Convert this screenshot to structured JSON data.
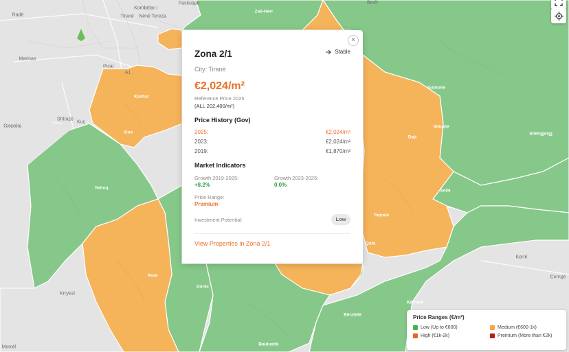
{
  "map": {
    "places": [
      {
        "name": "Radë",
        "tone": "dark"
      },
      {
        "name": "Tiranë",
        "tone": "dark"
      },
      {
        "name": "Nënë Tereza",
        "tone": "dark"
      },
      {
        "name": "Kombëtar i",
        "tone": "dark"
      },
      {
        "name": "Zall-Herr",
        "tone": "light"
      },
      {
        "name": "Besh",
        "tone": "dark"
      },
      {
        "name": "Paskuqan",
        "tone": "dark"
      },
      {
        "name": "Marinas",
        "tone": "dark"
      },
      {
        "name": "Picar",
        "tone": "dark"
      },
      {
        "name": "A1",
        "tone": "dark"
      },
      {
        "name": "Kashar",
        "tone": "light"
      },
      {
        "name": "Shtrazë",
        "tone": "dark"
      },
      {
        "name": "Kuç",
        "tone": "dark"
      },
      {
        "name": "Gjepalaj",
        "tone": "dark"
      },
      {
        "name": "Kus",
        "tone": "light"
      },
      {
        "name": "Ndroq",
        "tone": "light"
      },
      {
        "name": "Dajt",
        "tone": "light"
      },
      {
        "name": "Shëngjergj",
        "tone": "light"
      },
      {
        "name": "Gamolle",
        "tone": "light"
      },
      {
        "name": "Shkallë",
        "tone": "light"
      },
      {
        "name": "Sellë",
        "tone": "light"
      },
      {
        "name": "Petrelë",
        "tone": "light"
      },
      {
        "name": "Qafa",
        "tone": "light"
      },
      {
        "name": "Korrë",
        "tone": "dark"
      },
      {
        "name": "Cerrujë",
        "tone": "dark"
      },
      {
        "name": "Pezë",
        "tone": "light"
      },
      {
        "name": "Dorëz",
        "tone": "light"
      },
      {
        "name": "Krryezi",
        "tone": "dark"
      },
      {
        "name": "Kërrabë",
        "tone": "light"
      },
      {
        "name": "Bërzhitë",
        "tone": "light"
      },
      {
        "name": "Momël",
        "tone": "dark"
      },
      {
        "name": "Baldushk",
        "tone": "light"
      }
    ],
    "controls": {
      "fullscreen_icon": "fullscreen-icon",
      "locate_icon": "crosshair-icon"
    }
  },
  "popup": {
    "title": "Zona 2/1",
    "trend_label": "Stable",
    "trend_icon": "arrow-right-icon",
    "close_glyph": "×",
    "city_line": "City: Tiranë",
    "price": "€2,024/m²",
    "reference_label": "Reference Price 2025",
    "reference_all": "(ALL 202,400/m²)",
    "history_title": "Price History (Gov)",
    "history": [
      {
        "year": "2025:",
        "value": "€2,024/m²",
        "current": true
      },
      {
        "year": "2023:",
        "value": "€2,024/m²",
        "current": false
      },
      {
        "year": "2019:",
        "value": "€1,870/m²",
        "current": false
      }
    ],
    "indicators_title": "Market Indicators",
    "growth_2019_label": "Growth 2019-2025:",
    "growth_2019_value": "+8.2%",
    "growth_2023_label": "Growth 2023-2025:",
    "growth_2023_value": "0.0%",
    "price_range_label": "Price Range:",
    "price_range_value": "Premium",
    "investment_label": "Investment Potential:",
    "investment_value": "Low",
    "view_link": "View Properties in Zona 2/1"
  },
  "legend": {
    "title": "Price Ranges (€/m²)",
    "items": [
      {
        "label": "Low (Up to €600)",
        "color": "#4caf50"
      },
      {
        "label": "Medium (€600-1k)",
        "color": "#f5a742"
      },
      {
        "label": "High (€1k-2k)",
        "color": "#e8622a"
      },
      {
        "label": "Premium (More than €2k)",
        "color": "#b71c1c"
      }
    ]
  },
  "colors": {
    "accent": "#e8702a",
    "positive": "#2e9e44",
    "zone_low": "#86c88a",
    "zone_medium": "#f5b35a",
    "base_map": "#e4e4e4"
  }
}
